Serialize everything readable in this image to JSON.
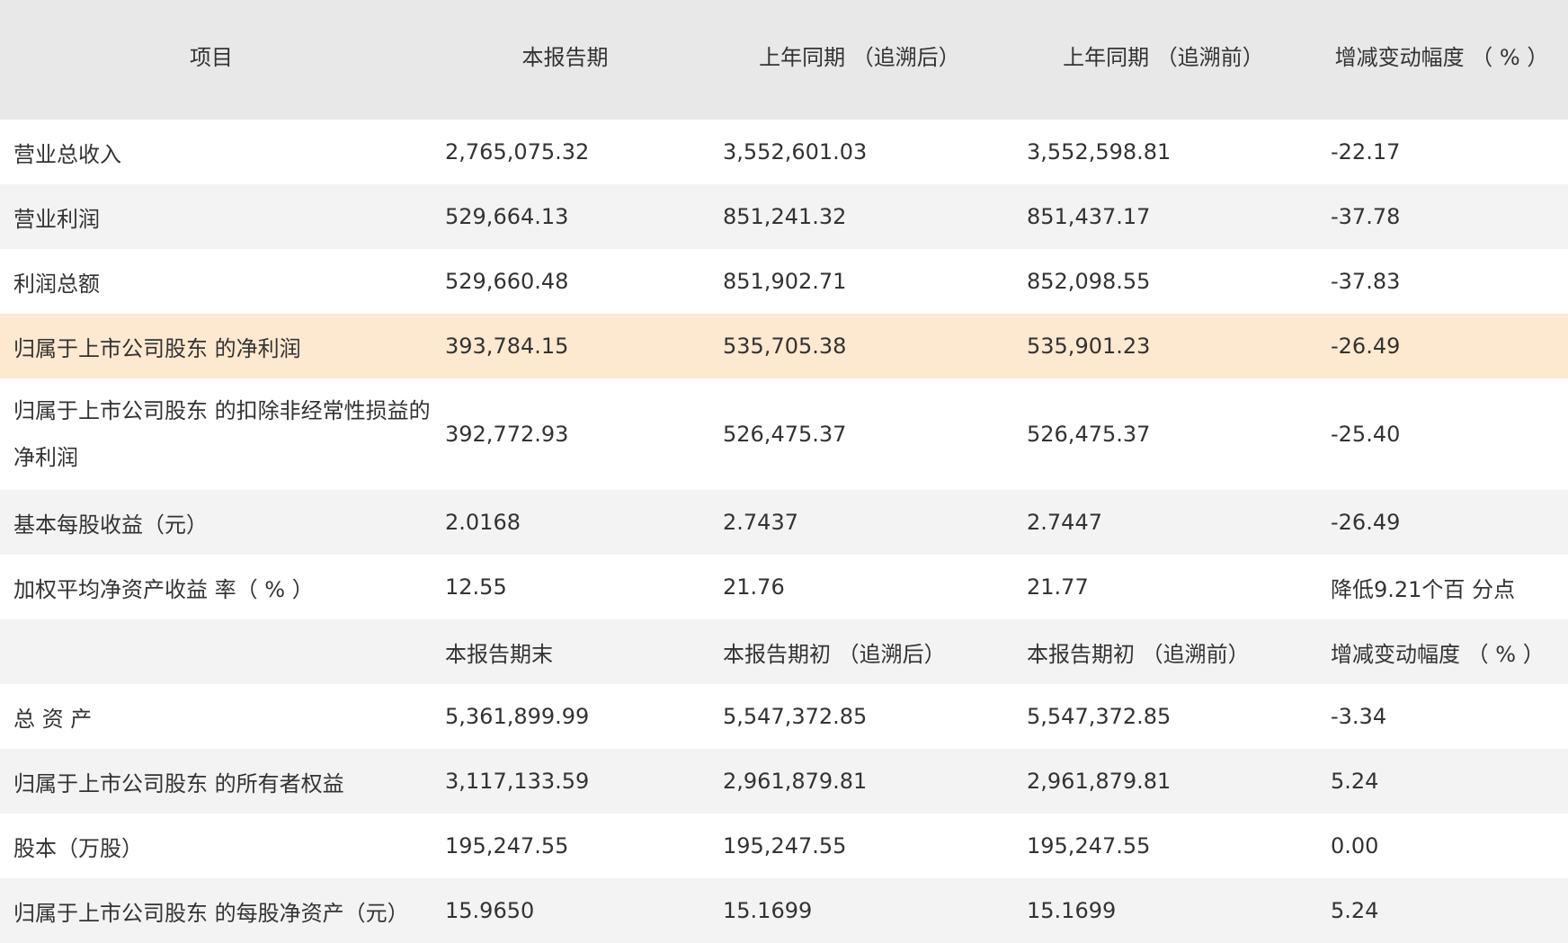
{
  "header": [
    "项目",
    "本报告期",
    "上年同期 （追溯后）",
    "上年同期 （追溯前）",
    "增减变动幅度 （ % ）"
  ],
  "rows": [
    {
      "cells": [
        "营业总收入",
        "2,765,075.32",
        "3,552,601.03",
        "3,552,598.81",
        "-22.17"
      ]
    },
    {
      "cells": [
        "营业利润",
        "529,664.13",
        "851,241.32",
        "851,437.17",
        "-37.78"
      ]
    },
    {
      "cells": [
        "利润总额",
        "529,660.48",
        "851,902.71",
        "852,098.55",
        "-37.83"
      ]
    },
    {
      "cells": [
        "归属于上市公司股东 的净利润",
        "393,784.15",
        "535,705.38",
        "535,901.23",
        "-26.49"
      ]
    },
    {
      "cells": [
        "归属于上市公司股东 的扣除非经常性损益的净利润",
        "392,772.93",
        "526,475.37",
        "526,475.37",
        "-25.40"
      ]
    },
    {
      "cells": [
        "基本每股收益（元）",
        "2.0168",
        "2.7437",
        "2.7447",
        "-26.49"
      ]
    },
    {
      "cells": [
        "加权平均净资产收益 率（ % ）",
        "12.55",
        "21.76",
        "21.77",
        "降低9.21个百 分点"
      ]
    },
    {
      "cells": [
        "",
        "本报告期末",
        "本报告期初 （追溯后）",
        "本报告期初 （追溯前）",
        "增减变动幅度 （ % ）"
      ]
    },
    {
      "cells": [
        "总 资 产",
        "5,361,899.99",
        "5,547,372.85",
        "5,547,372.85",
        "-3.34"
      ]
    },
    {
      "cells": [
        "归属于上市公司股东 的所有者权益",
        "3,117,133.59",
        "2,961,879.81",
        "2,961,879.81",
        "5.24"
      ]
    },
    {
      "cells": [
        "股本（万股）",
        "195,247.55",
        "195,247.55",
        "195,247.55",
        "0.00"
      ]
    },
    {
      "cells": [
        "归属于上市公司股东 的每股净资产（元）",
        "15.9650",
        "15.1699",
        "15.1699",
        "5.24"
      ]
    }
  ],
  "colors": {
    "header_bg": "#e8e8e8",
    "row_white": "#ffffff",
    "row_grey": "#f3f3f3",
    "row_highlight": "#fde9cf",
    "text": "#333333"
  }
}
